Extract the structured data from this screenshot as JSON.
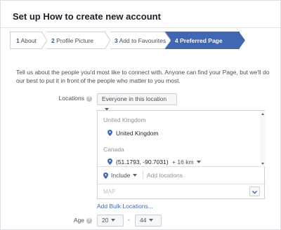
{
  "header": {
    "title": "Set up How to create new account"
  },
  "steps": [
    {
      "num": "1",
      "label": "About"
    },
    {
      "num": "2",
      "label": "Profile Picture"
    },
    {
      "num": "3",
      "label": "Add to Favourites"
    },
    {
      "num": "4",
      "label": "Preferred Page Audience"
    }
  ],
  "description": "Tell us about the people you'd most like to connect with. Anyone can find your Page, but we'll do our best to put it in front of the people who matter to you most.",
  "locations": {
    "label": "Locations",
    "dropdown": "Everyone in this location",
    "groups": [
      {
        "country": "United Kingdom",
        "item": "United Kingdom"
      },
      {
        "country": "Canada",
        "item": "(51.1793, -90.7031)",
        "radius": "+ 16 km"
      }
    ],
    "include_label": "Include",
    "add_placeholder": "Add locations",
    "map_label": "MAP",
    "bulk_link": "Add Bulk Locations..."
  },
  "age": {
    "label": "Age",
    "min": "20",
    "separator": "-",
    "max": "44"
  },
  "colors": {
    "accent": "#4267b2",
    "link": "#365899"
  }
}
